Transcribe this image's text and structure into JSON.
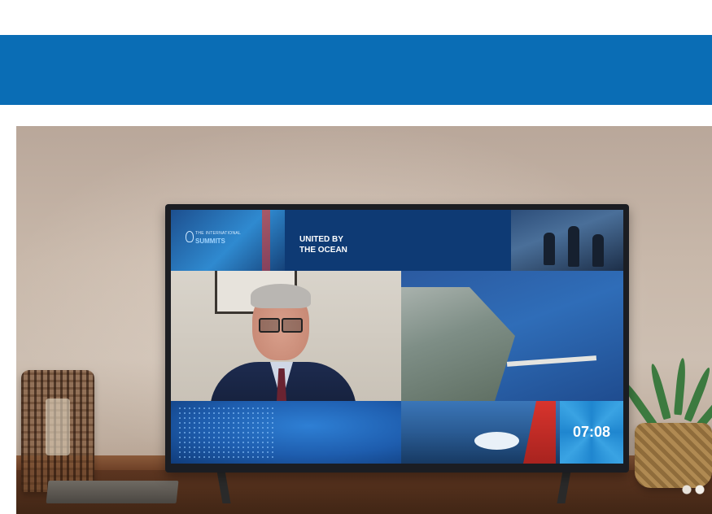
{
  "screen": {
    "logo_small": "THE INTERNATIONAL",
    "logo_big": "SUMMITS",
    "title_line1": "UNITED BY",
    "title_line2": "THE OCEAN",
    "timer": "07:08"
  },
  "colors": {
    "banner": "#0a6db5",
    "screen_bg": "#0c2f63",
    "sail_red": "#d8342d"
  }
}
